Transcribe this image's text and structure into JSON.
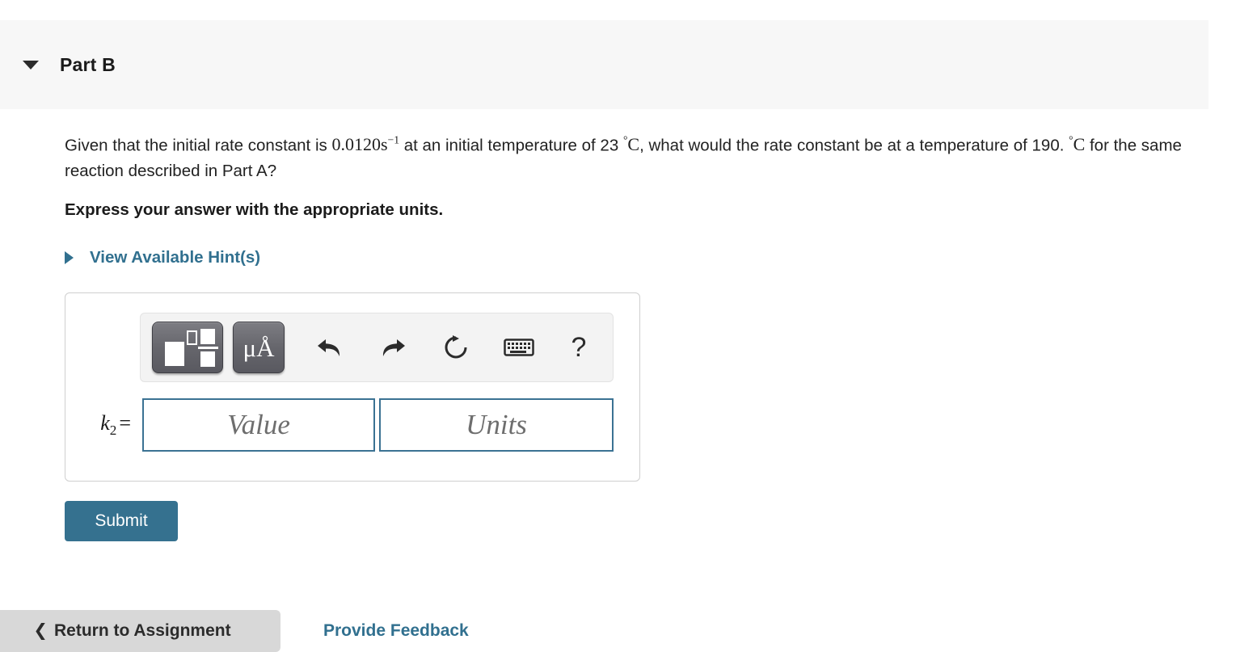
{
  "part": {
    "title": "Part B",
    "caret_icon": "triangle-down-icon",
    "expanded": true
  },
  "question": {
    "line1_a": "Given that the initial rate constant is ",
    "rate_constant": "0.0120s",
    "rate_constant_exp": "−1",
    "line1_b": " at an initial temperature of 23 ",
    "temp_unit_1_deg": "°",
    "temp_unit_1_c": "C",
    "line1_c": ", what would the rate constant be at a temperature of 190. ",
    "temp_unit_2_deg": "°",
    "temp_unit_2_c": "C",
    "line1_d": " for the same reaction described in Part A?",
    "instruction": "Express your answer with the appropriate units."
  },
  "hints": {
    "label": "View Available Hint(s)",
    "caret_icon": "triangle-right-icon",
    "color": "#31708f"
  },
  "answer": {
    "toolbar": {
      "template_button": {
        "name": "template-button",
        "glyph": "box-superscript-fraction"
      },
      "units_button": {
        "name": "units-button",
        "glyph": "μÅ"
      },
      "undo": "undo-icon",
      "redo": "redo-icon",
      "reset": "reset-icon",
      "keyboard": "keyboard-icon",
      "help": "?"
    },
    "variable_label": "k",
    "variable_subscript": "2",
    "equals": "=",
    "value_field": {
      "value": "",
      "placeholder": "Value"
    },
    "units_field": {
      "value": "",
      "placeholder": "Units"
    },
    "border_color": "#3b7293"
  },
  "actions": {
    "submit_label": "Submit",
    "submit_color": "#35718f",
    "return_label": "Return to Assignment",
    "return_icon": "back-arrow-icon",
    "feedback_label": "Provide Feedback"
  }
}
